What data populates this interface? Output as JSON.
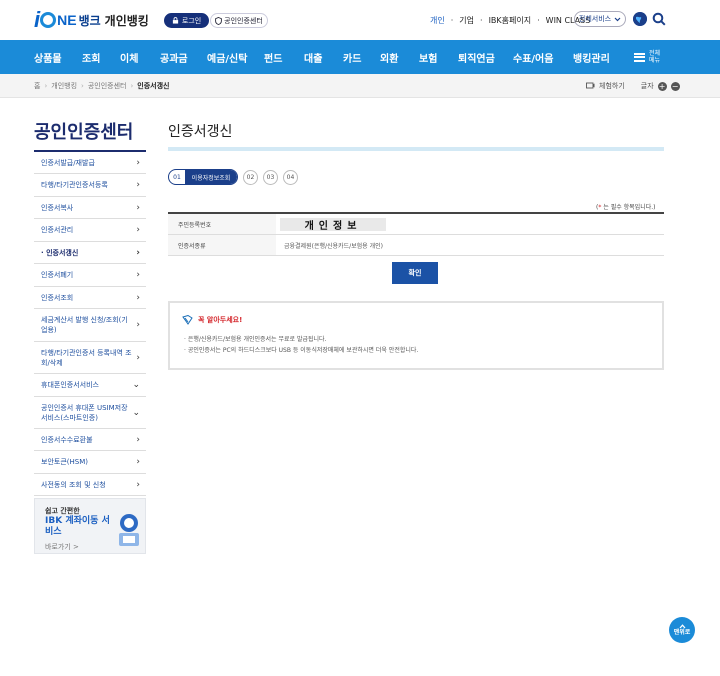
{
  "header": {
    "brand_bank": "뱅크",
    "brand_personal": "개인뱅킹",
    "login_label": "로그인",
    "cert_label": "공인인증센터",
    "links": [
      {
        "label": "개인",
        "active": true
      },
      {
        "label": "기업",
        "active": false
      },
      {
        "label": "IBK홈페이지",
        "active": false
      },
      {
        "label": "WIN CLASS",
        "active": false
      }
    ],
    "all_services": "전체서비스"
  },
  "nav": {
    "items": [
      "상품몰",
      "조회",
      "이체",
      "공과금",
      "예금/신탁",
      "펀드",
      "대출",
      "카드",
      "외환",
      "보험",
      "퇴직연금",
      "수표/어음",
      "뱅킹관리"
    ],
    "all_menu": "전체메뉴"
  },
  "breadcrumb": {
    "items": [
      "홈",
      "개인뱅킹",
      "공인인증센터",
      "인증서갱신"
    ],
    "experience": "체험하기",
    "font_size": "글자"
  },
  "sidebar": {
    "title": "공인인증센터",
    "items": [
      {
        "label": "인증서발급/재발급",
        "active": false,
        "chev": "›"
      },
      {
        "label": "타행/타기관인증서등록",
        "active": false,
        "chev": "›"
      },
      {
        "label": "인증서복사",
        "active": false,
        "chev": "›"
      },
      {
        "label": "인증서관리",
        "active": false,
        "chev": "›"
      },
      {
        "label": "· 인증서갱신",
        "active": true,
        "chev": "›"
      },
      {
        "label": "인증서폐기",
        "active": false,
        "chev": "›"
      },
      {
        "label": "인증서조회",
        "active": false,
        "chev": "›"
      },
      {
        "label": "세금계산서 발행 신청/조회(기업용)",
        "active": false,
        "chev": "›"
      },
      {
        "label": "타행/타기관인증서 등록내역 조회/삭제",
        "active": false,
        "chev": "›"
      },
      {
        "label": "휴대폰인증서서비스",
        "active": false,
        "chev": "⌄"
      },
      {
        "label": "공인인증서 휴대폰 USIM저장 서비스(스마트인증)",
        "active": false,
        "chev": "⌄"
      },
      {
        "label": "인증서수수료환불",
        "active": false,
        "chev": "›"
      },
      {
        "label": "보안토큰(HSM)",
        "active": false,
        "chev": "›"
      },
      {
        "label": "사전동의 조회 및 신청",
        "active": false,
        "chev": "›"
      }
    ],
    "banner": {
      "line1": "쉽고 간편한",
      "line2": "IBK 계좌이동 서비스",
      "line3": "바로가기 >"
    }
  },
  "main": {
    "title": "인증서갱신",
    "steps": {
      "active_num": "01",
      "active_label": "이용자정보조회",
      "others": [
        "02",
        "03",
        "04"
      ]
    },
    "required_note": "는 필수 항목입니다.",
    "required_star": "*",
    "form": {
      "rows": [
        {
          "label": "주민등록번호",
          "value": "개인정보"
        },
        {
          "label": "인증서종류",
          "value": "금융결제원(은행/신용카드/보험용 개인)"
        }
      ]
    },
    "confirm_label": "확인",
    "notice": {
      "title": "꼭 알아두세요!",
      "items": [
        "은행/신용카드/보험용 개인인증서는 무료로 발급됩니다.",
        "공인인증서는 PC의 하드디스크보다 USB 등 이동식저장매체에 보관하시면 더욱 안전합니다."
      ]
    },
    "top_button": "맨위로"
  },
  "colors": {
    "nav_bg": "#1b8bd8",
    "navy": "#1c2c6e",
    "confirm_bg": "#1b52a6",
    "required": "#d4262b"
  }
}
